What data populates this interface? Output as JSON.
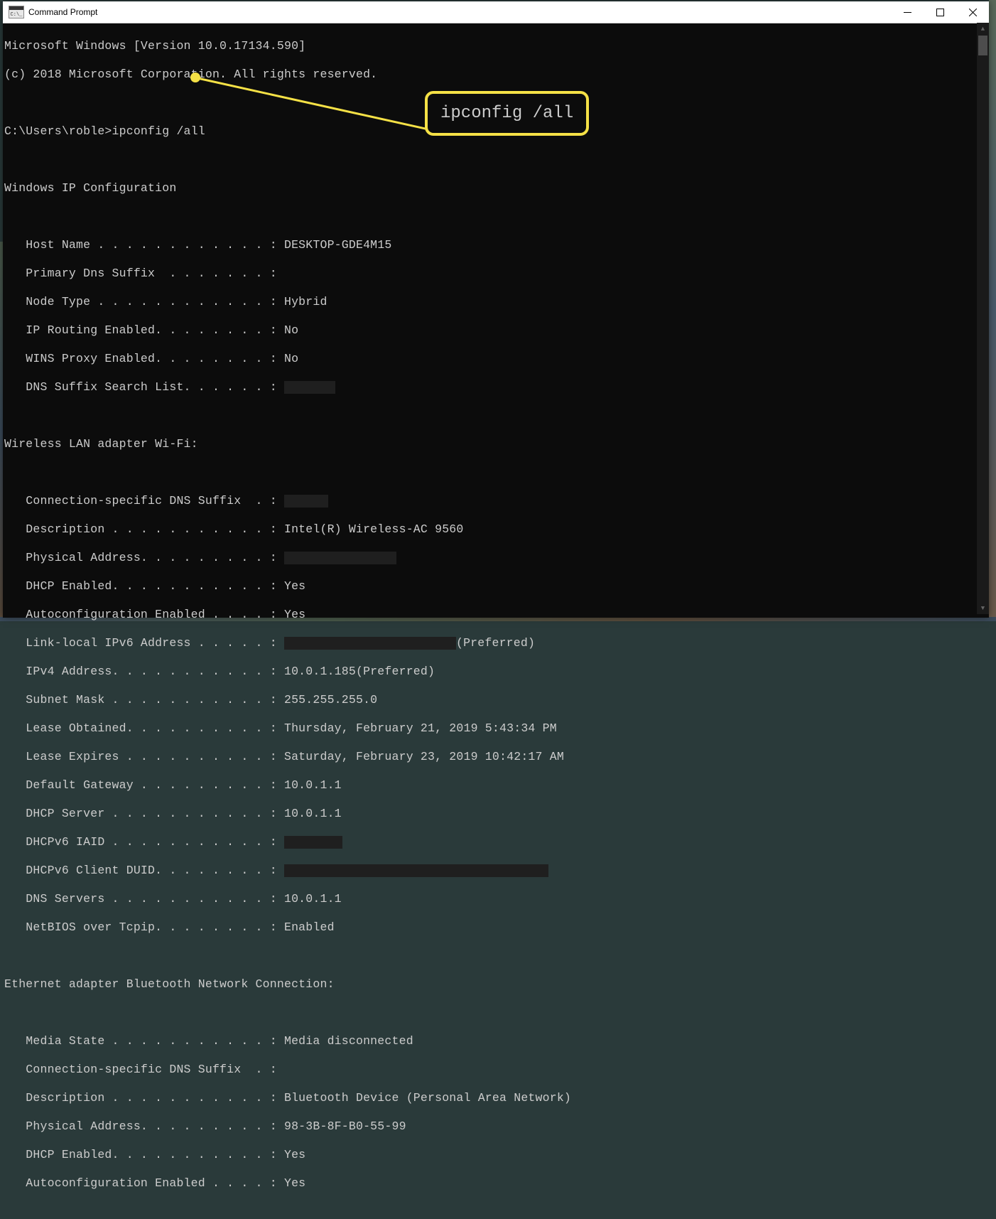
{
  "window": {
    "title": "Command Prompt",
    "icon_label": "C:\\_"
  },
  "callout": {
    "text": "ipconfig /all"
  },
  "terminal": {
    "header1": "Microsoft Windows [Version 10.0.17134.590]",
    "header2": "(c) 2018 Microsoft Corporation. All rights reserved.",
    "prompt": "C:\\Users\\roble>ipconfig /all",
    "section_winip": "Windows IP Configuration",
    "winip": {
      "host_name": "   Host Name . . . . . . . . . . . . : DESKTOP-GDE4M15",
      "dns_suffix": "   Primary Dns Suffix  . . . . . . . :",
      "node_type": "   Node Type . . . . . . . . . . . . : Hybrid",
      "ip_routing": "   IP Routing Enabled. . . . . . . . : No",
      "wins_proxy": "   WINS Proxy Enabled. . . . . . . . : No",
      "dns_search": "   DNS Suffix Search List. . . . . . : "
    },
    "section_wifi": "Wireless LAN adapter Wi-Fi:",
    "wifi": {
      "conn_suffix": "   Connection-specific DNS Suffix  . : ",
      "description": "   Description . . . . . . . . . . . : Intel(R) Wireless-AC 9560",
      "phys_addr": "   Physical Address. . . . . . . . . : ",
      "dhcp_en": "   DHCP Enabled. . . . . . . . . . . : Yes",
      "autoconf": "   Autoconfiguration Enabled . . . . : Yes",
      "ipv6_pre": "   Link-local IPv6 Address . . . . . : ",
      "ipv6_post": "(Preferred)",
      "ipv4": "   IPv4 Address. . . . . . . . . . . : 10.0.1.185(Preferred)",
      "subnet": "   Subnet Mask . . . . . . . . . . . : 255.255.255.0",
      "lease_obt": "   Lease Obtained. . . . . . . . . . : Thursday, February 21, 2019 5:43:34 PM",
      "lease_exp": "   Lease Expires . . . . . . . . . . : Saturday, February 23, 2019 10:42:17 AM",
      "gateway": "   Default Gateway . . . . . . . . . : 10.0.1.1",
      "dhcp_srv": "   DHCP Server . . . . . . . . . . . : 10.0.1.1",
      "dhcpv6_iaid": "   DHCPv6 IAID . . . . . . . . . . . : ",
      "dhcpv6_duid": "   DHCPv6 Client DUID. . . . . . . . : ",
      "dns_srv": "   DNS Servers . . . . . . . . . . . : 10.0.1.1",
      "netbios": "   NetBIOS over Tcpip. . . . . . . . : Enabled"
    },
    "section_bt": "Ethernet adapter Bluetooth Network Connection:",
    "bt": {
      "media": "   Media State . . . . . . . . . . . : Media disconnected",
      "conn_suffix": "   Connection-specific DNS Suffix  . :",
      "description": "   Description . . . . . . . . . . . : Bluetooth Device (Personal Area Network)",
      "phys_addr": "   Physical Address. . . . . . . . . : 98-3B-8F-B0-55-99",
      "dhcp_en": "   DHCP Enabled. . . . . . . . . . . : Yes",
      "autoconf": "   Autoconfiguration Enabled . . . . : Yes"
    }
  }
}
